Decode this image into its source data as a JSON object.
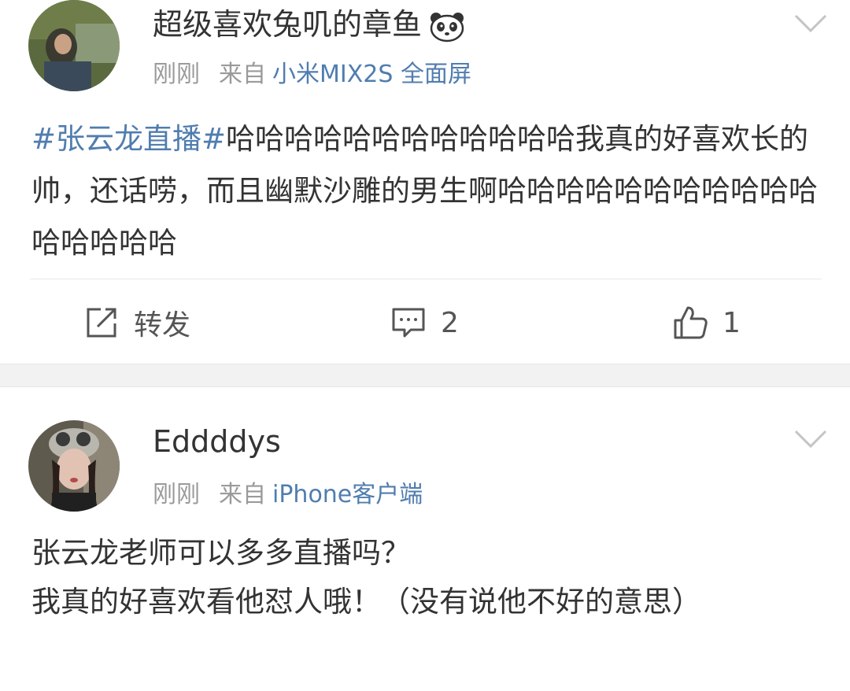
{
  "posts": [
    {
      "username": "超级喜欢兔叽的章鱼",
      "time": "刚刚",
      "from_label": "来自",
      "source": "小米MIX2S 全面屏",
      "topic": "#张云龙直播#",
      "text": "哈哈哈哈哈哈哈哈哈哈哈哈我真的好喜欢长的帅，还话唠，而且幽默沙雕的男生啊哈哈哈哈哈哈哈哈哈哈哈哈哈哈哈哈",
      "actions": {
        "repost_label": "转发",
        "comment_count": "2",
        "like_count": "1"
      }
    },
    {
      "username": "Eddddys",
      "time": "刚刚",
      "from_label": "来自",
      "source": "iPhone客户端",
      "text_line1": "张云龙老师可以多多直播吗？",
      "text_line2": "我真的好喜欢看他怼人哦！（没有说他不好的意思）"
    }
  ],
  "icons": {
    "emoji": "panda-icon",
    "menu": "chevron-down-icon",
    "repost": "repost-icon",
    "comment": "comment-icon",
    "like": "thumbs-up-icon"
  },
  "colors": {
    "link": "#507daf",
    "meta": "#9a9a9a",
    "text": "#333333",
    "separator": "#f2f2f2"
  }
}
